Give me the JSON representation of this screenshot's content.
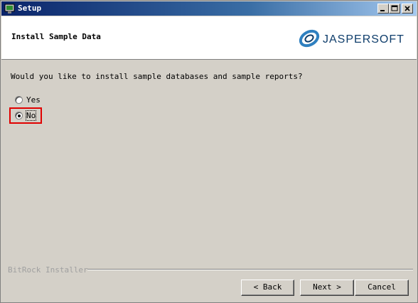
{
  "window": {
    "title": "Setup",
    "minimize_icon": "minimize-icon",
    "maximize_icon": "maximize-icon",
    "close_icon": "close-icon"
  },
  "header": {
    "title": "Install Sample Data",
    "logo_text": "JASPERSOFT"
  },
  "content": {
    "question": "Would you like to install sample databases and sample reports?",
    "options": [
      {
        "label": "Yes",
        "selected": false
      },
      {
        "label": "No",
        "selected": true
      }
    ]
  },
  "footer": {
    "brand": "BitRock Installer",
    "back_label": "< Back",
    "next_label": "Next >",
    "cancel_label": "Cancel"
  },
  "colors": {
    "title_bar": "#0a246a",
    "dialog_bg": "#d4d0c8",
    "highlight": "#e00000",
    "logo": "#0e3d6b"
  }
}
